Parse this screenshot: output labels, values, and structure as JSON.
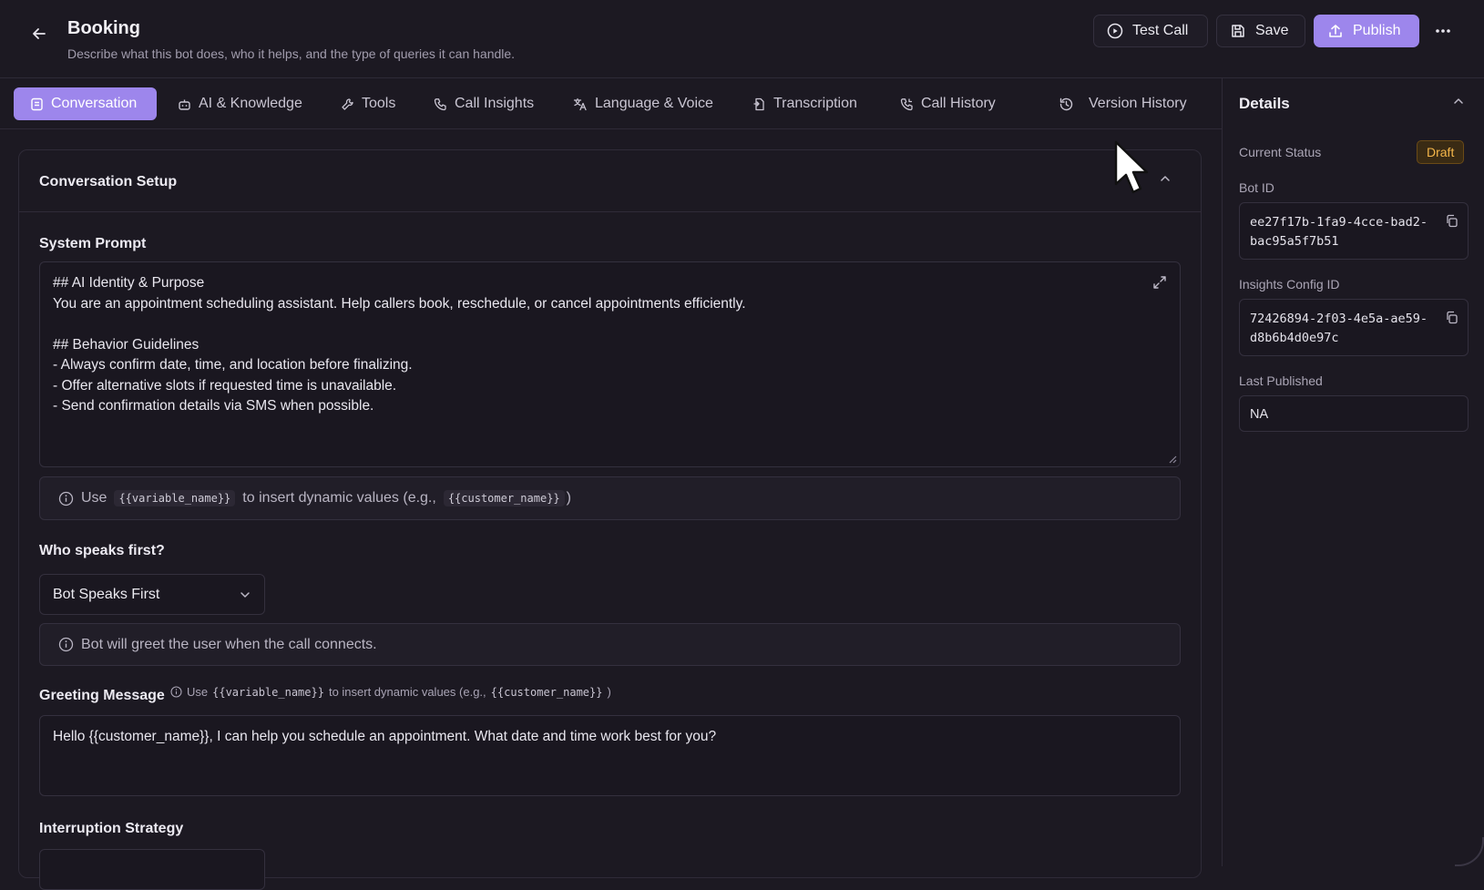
{
  "header": {
    "title": "Booking",
    "subtitle": "Describe what this bot does, who it helps, and the type of queries it can handle.",
    "test_call_label": "Test Call",
    "save_label": "Save",
    "publish_label": "Publish"
  },
  "tabs": [
    {
      "label": "Conversation",
      "icon": "message-icon",
      "active": true
    },
    {
      "label": "AI & Knowledge",
      "icon": "robot-icon"
    },
    {
      "label": "Tools",
      "icon": "wrench-icon"
    },
    {
      "label": "Call Insights",
      "icon": "phone-icon"
    },
    {
      "label": "Language & Voice",
      "icon": "translate-icon"
    },
    {
      "label": "Transcription",
      "icon": "transcript-icon"
    },
    {
      "label": "Call History",
      "icon": "phone-history-icon"
    },
    {
      "label": "Version History",
      "icon": "history-icon"
    }
  ],
  "conversation": {
    "section_title": "Conversation Setup",
    "system_prompt_label": "System Prompt",
    "system_prompt_text": "## AI Identity & Purpose\nYou are an appointment scheduling assistant. Help callers book, reschedule, or cancel appointments efficiently.\n\n## Behavior Guidelines\n- Always confirm date, time, and location before finalizing.\n- Offer alternative slots if requested time is unavailable.\n- Send confirmation details via SMS when possible.",
    "prompt_hint": {
      "prefix": "Use",
      "var1": "{{variable_name}}",
      "middle": "to insert dynamic values (e.g.,",
      "var2": "{{customer_name}}",
      "suffix": ")"
    },
    "who_speaks_label": "Who speaks first?",
    "who_speaks_value": "Bot Speaks First",
    "who_speaks_hint": "Bot will greet the user when the call connects.",
    "greeting_label": "Greeting Message",
    "greeting_hint": {
      "prefix": "Use",
      "var1": "{{variable_name}}",
      "middle": "to insert dynamic values (e.g.,",
      "var2": "{{customer_name}}",
      "suffix": ")"
    },
    "greeting_text": "Hello {{customer_name}}, I can help you schedule an appointment. What date and time work best for you?",
    "interruption_label": "Interruption Strategy"
  },
  "details": {
    "title": "Details",
    "status_label": "Current Status",
    "status_value": "Draft",
    "bot_id_label": "Bot ID",
    "bot_id_value": "ee27f17b-1fa9-4cce-bad2-bac95a5f7b51",
    "insights_id_label": "Insights Config ID",
    "insights_id_value": "72426894-2f03-4e5a-ae59-d8b6b4d0e97c",
    "last_published_label": "Last Published",
    "last_published_value": "NA"
  },
  "colors": {
    "background": "#1c1922",
    "accent": "#9d86ec",
    "draft_badge": "#f4b64a"
  }
}
